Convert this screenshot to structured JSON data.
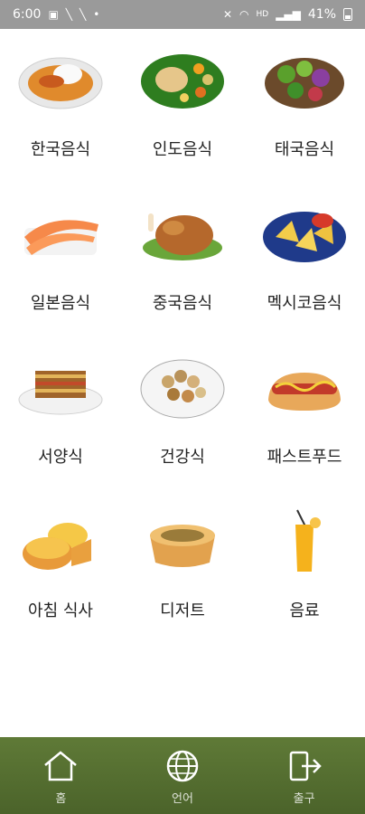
{
  "status_bar": {
    "time": "6:00",
    "battery": "41%",
    "left_icons": [
      "image-icon",
      "phone-call-icon",
      "phone-call-icon",
      "dot-icon"
    ],
    "right_icons": [
      "mute-icon",
      "wifi-icon",
      "hd-icon",
      "signal-icon",
      "battery-icon"
    ]
  },
  "categories": [
    {
      "label": "한국음식",
      "icon": "korean-food-icon"
    },
    {
      "label": "인도음식",
      "icon": "indian-food-icon"
    },
    {
      "label": "태국음식",
      "icon": "thai-food-icon"
    },
    {
      "label": "일본음식",
      "icon": "japanese-food-icon"
    },
    {
      "label": "중국음식",
      "icon": "chinese-food-icon"
    },
    {
      "label": "멕시코음식",
      "icon": "mexican-food-icon"
    },
    {
      "label": "서양식",
      "icon": "western-food-icon"
    },
    {
      "label": "건강식",
      "icon": "healthy-food-icon"
    },
    {
      "label": "패스트푸드",
      "icon": "fast-food-icon"
    },
    {
      "label": "아침 식사",
      "icon": "breakfast-icon"
    },
    {
      "label": "디저트",
      "icon": "dessert-icon"
    },
    {
      "label": "음료",
      "icon": "drink-icon"
    }
  ],
  "bottom_nav": [
    {
      "label": "홈",
      "icon": "home-icon"
    },
    {
      "label": "언어",
      "icon": "globe-icon"
    },
    {
      "label": "출구",
      "icon": "exit-icon"
    }
  ],
  "colors": {
    "status_bar": "#9a9a9a",
    "bottom_nav": "#5f7a37",
    "background": "#ffffff"
  }
}
